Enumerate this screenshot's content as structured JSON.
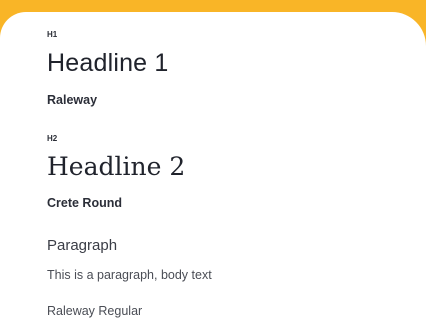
{
  "h1_section": {
    "tag": "H1",
    "sample": "Headline 1",
    "font_name": "Raleway"
  },
  "h2_section": {
    "tag": "H2",
    "sample": "Headline 2",
    "font_name": "Crete Round"
  },
  "paragraph_section": {
    "title": "Paragraph",
    "sample": "This is a paragraph, body text",
    "font_name": "Raleway Regular"
  },
  "colors": {
    "background": "#f9b527",
    "card": "#ffffff",
    "text": "#20232c"
  }
}
